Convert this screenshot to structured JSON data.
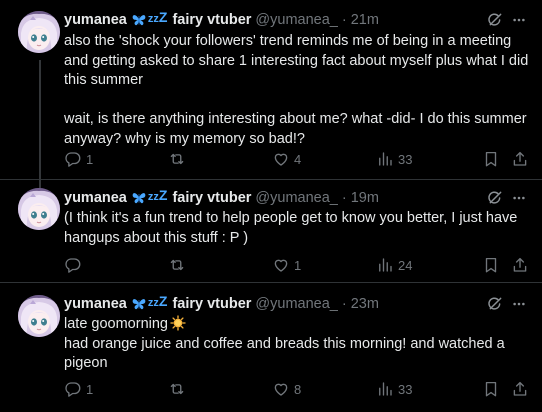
{
  "author": {
    "name": "yumanea",
    "decoration_icons": [
      "butterfly-icon",
      "sleep-zz-icon"
    ],
    "zz_small": "z",
    "zz_mid": "z",
    "zz_big": "Z",
    "title": "fairy vtuber",
    "handle": "@yumanea_",
    "separator": "·"
  },
  "colors": {
    "background": "#000000",
    "text": "#e7e9ea",
    "muted": "#71767b",
    "divider": "#2f3336",
    "accent_blue": "#4aa8ff"
  },
  "tweets": [
    {
      "time": "21m",
      "text": "also the 'shock your followers' trend reminds me of being in a meeting and getting asked to share 1 interesting fact about myself plus what I did this summer\n\nwait, is there anything interesting about me? what -did- I do this summer anyway? why is my memory so bad!?",
      "replies": "1",
      "reposts": "",
      "likes": "4",
      "views": "33"
    },
    {
      "time": "19m",
      "text": "(I think it's a fun trend to help people get to know you better, I just have hangups about this stuff : P )",
      "replies": "",
      "reposts": "",
      "likes": "1",
      "views": "24"
    },
    {
      "time": "23m",
      "text_line1": "late goomorning",
      "emoji": "sun-icon",
      "text_rest": "had orange juice and coffee and breads this morning! and watched a pigeon",
      "replies": "1",
      "reposts": "",
      "likes": "8",
      "views": "33"
    }
  ]
}
